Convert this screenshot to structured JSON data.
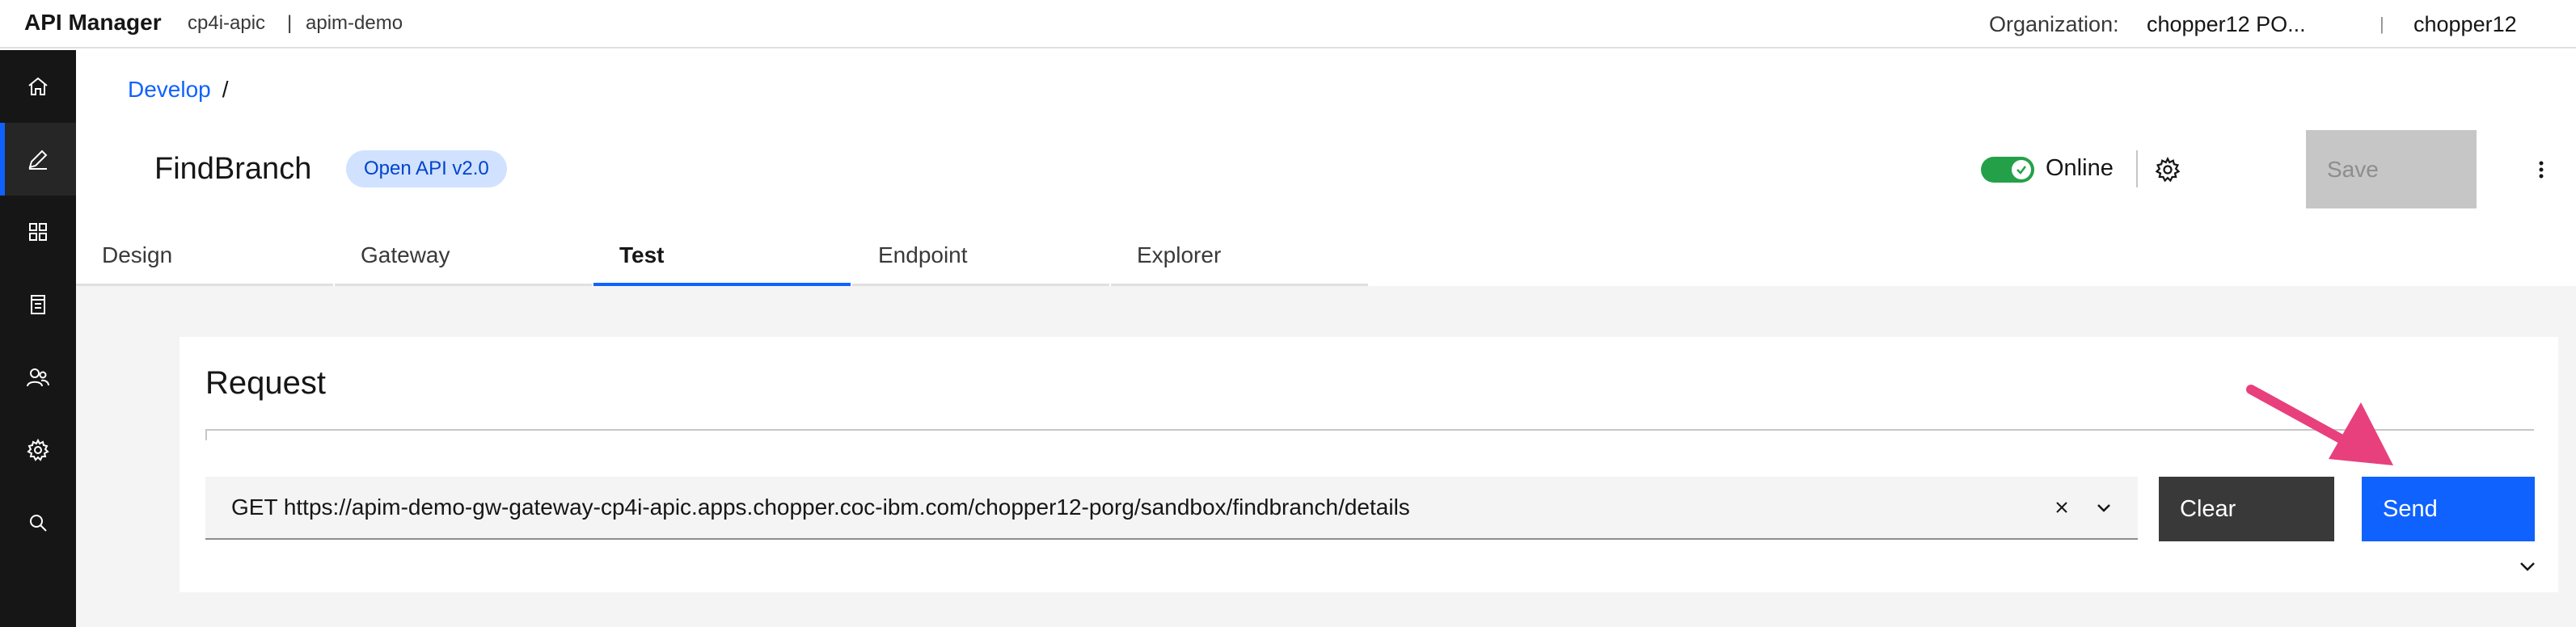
{
  "header": {
    "brand": "API Manager",
    "context_catalog": "cp4i-apic",
    "context_separator": "|",
    "context_instance": "apim-demo",
    "org_label": "Organization:",
    "org_value": "chopper12 PO...",
    "org_separator": "|",
    "user": "chopper12"
  },
  "sidebar": {
    "items": [
      {
        "name": "home",
        "icon": "home-icon",
        "active": false
      },
      {
        "name": "develop",
        "icon": "edit-icon",
        "active": true
      },
      {
        "name": "manage",
        "icon": "grid-icon",
        "active": false
      },
      {
        "name": "analytics",
        "icon": "document-icon",
        "active": false
      },
      {
        "name": "members",
        "icon": "users-icon",
        "active": false
      },
      {
        "name": "settings",
        "icon": "gear-icon",
        "active": false
      },
      {
        "name": "search",
        "icon": "search-icon",
        "active": false
      }
    ]
  },
  "breadcrumb": {
    "link": "Develop",
    "separator": "/"
  },
  "api": {
    "title": "FindBranch",
    "tag": "Open API v2.0",
    "status_label": "Online",
    "save_label": "Save"
  },
  "tabs": [
    {
      "label": "Design",
      "active": false
    },
    {
      "label": "Gateway",
      "active": false
    },
    {
      "label": "Test",
      "active": true
    },
    {
      "label": "Endpoint",
      "active": false
    },
    {
      "label": "Explorer",
      "active": false
    }
  ],
  "request": {
    "title": "Request",
    "url": "GET https://apim-demo-gw-gateway-cp4i-apic.apps.chopper.coc-ibm.com/chopper12-porg/sandbox/findbranch/details",
    "clear_label": "Clear",
    "send_label": "Send"
  },
  "colors": {
    "accent": "#0f62fe",
    "toggle_on": "#24a148",
    "annotation_arrow": "#e8407c"
  }
}
